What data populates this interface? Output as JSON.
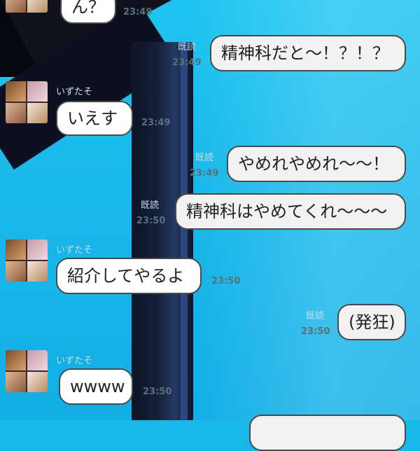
{
  "messages": [
    {
      "side": "left",
      "text": "ん？",
      "time": "23:49"
    },
    {
      "side": "right",
      "text": "精神科だと～！？！？",
      "read": "既読",
      "time": "23:49"
    },
    {
      "side": "left",
      "sender": "いずたそ",
      "text": "いえす",
      "time": "23:49"
    },
    {
      "side": "right",
      "text": "やめれやめれ～～！",
      "read": "既読",
      "time": "23:49"
    },
    {
      "side": "right",
      "text": "精神科はやめてくれ～～～",
      "read": "既読",
      "time": "23:50"
    },
    {
      "side": "left",
      "sender": "いずたそ",
      "text": "紹介してやるよ",
      "time": "23:50"
    },
    {
      "side": "right",
      "text": "(発狂)",
      "read": "既読",
      "time": "23:50"
    },
    {
      "side": "left",
      "sender": "いずたそ",
      "text": "wwww",
      "time": "23:50"
    }
  ],
  "colors": {
    "background": "#16b9ea",
    "bubble_border": "#4a4a4a",
    "bubble_bg": "#ffffff",
    "time_text": "#5a6f78"
  }
}
